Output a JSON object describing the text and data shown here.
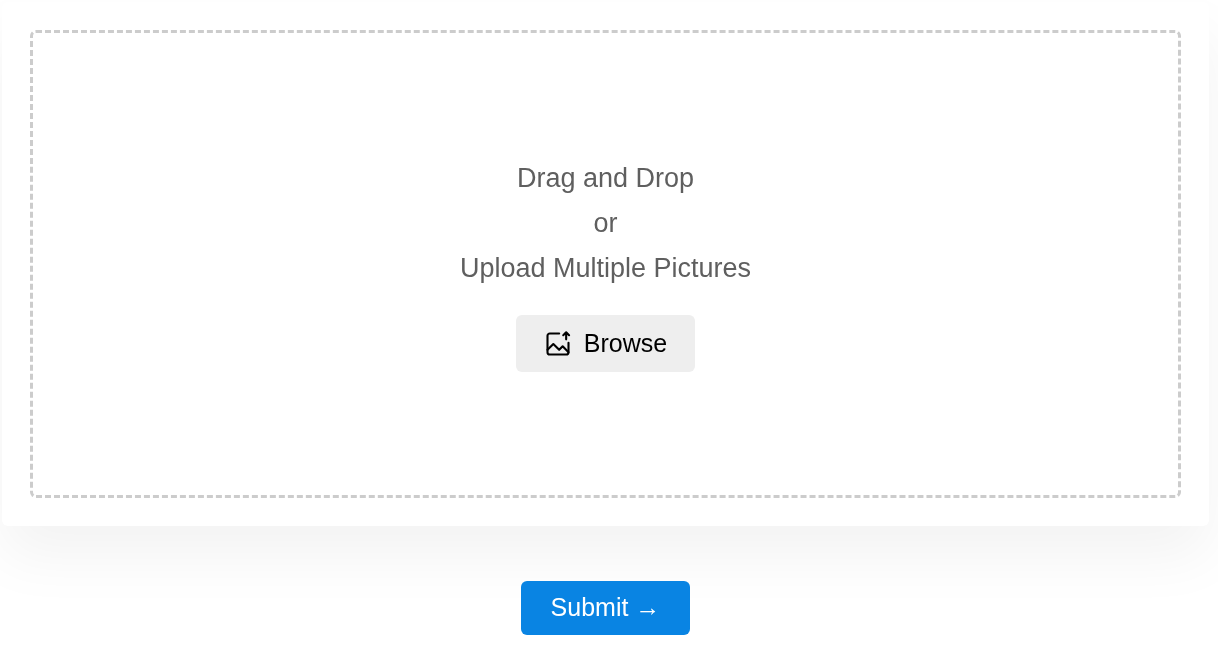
{
  "dropzone": {
    "lines": [
      "Drag and Drop",
      "or",
      "Upload Multiple Pictures"
    ],
    "browse_button": {
      "label": "Browse"
    }
  },
  "submit_button": {
    "label": "Submit →"
  }
}
